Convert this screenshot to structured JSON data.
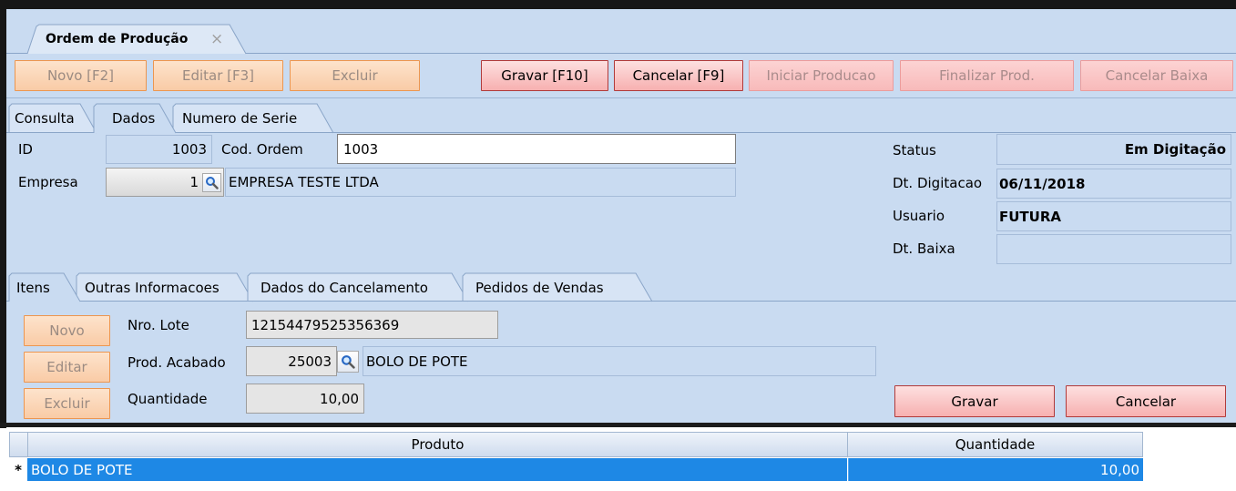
{
  "colors": {
    "panel_background": "#c9dbf1",
    "selected_row": "#1e88e5",
    "orange_button": "#f9cba6",
    "pink_button": "#f7b0b0"
  },
  "document_tab": {
    "title": "Ordem de Produção",
    "close_icon": "×"
  },
  "toolbar": {
    "buttons": [
      {
        "label": "Novo [F2]",
        "enabled": false
      },
      {
        "label": "Editar [F3]",
        "enabled": false
      },
      {
        "label": "Excluir",
        "enabled": false
      },
      {
        "label": "Gravar [F10]",
        "enabled": true
      },
      {
        "label": "Cancelar [F9]",
        "enabled": true
      },
      {
        "label": "Iniciar Producao",
        "enabled": false
      },
      {
        "label": "Finalizar Prod.",
        "enabled": false
      },
      {
        "label": "Cancelar Baixa",
        "enabled": false
      }
    ]
  },
  "main_tabs": [
    {
      "label": "Consulta",
      "active": false
    },
    {
      "label": "Dados",
      "active": true
    },
    {
      "label": "Numero de Serie",
      "active": false
    }
  ],
  "form": {
    "id_label": "ID",
    "id_value": "1003",
    "cod_ordem_label": "Cod. Ordem",
    "cod_ordem_value": "1003",
    "empresa_label": "Empresa",
    "empresa_code": "1",
    "empresa_name": "EMPRESA TESTE LTDA",
    "status_label": "Status",
    "status_value": "Em Digitação",
    "dt_digitacao_label": "Dt. Digitacao",
    "dt_digitacao_value": "06/11/2018",
    "usuario_label": "Usuario",
    "usuario_value": "FUTURA",
    "dt_baixa_label": "Dt. Baixa",
    "dt_baixa_value": ""
  },
  "sub_tabs": [
    {
      "label": "Itens",
      "active": true
    },
    {
      "label": "Outras Informacoes",
      "active": false
    },
    {
      "label": "Dados do Cancelamento",
      "active": false
    },
    {
      "label": "Pedidos de Vendas",
      "active": false
    }
  ],
  "items_panel": {
    "novo_button": {
      "label": "Novo",
      "enabled": false
    },
    "editar_button": {
      "label": "Editar",
      "enabled": false
    },
    "excluir_button": {
      "label": "Excluir",
      "enabled": false
    },
    "nro_lote_label": "Nro. Lote",
    "nro_lote_value": "12154479525356369",
    "prod_acabado_label": "Prod. Acabado",
    "prod_code": "25003",
    "prod_name": "BOLO DE POTE",
    "quantidade_label": "Quantidade",
    "quantidade_value": "10,00",
    "gravar_button": {
      "label": "Gravar",
      "enabled": true
    },
    "cancelar_button": {
      "label": "Cancelar",
      "enabled": true
    }
  },
  "grid": {
    "columns": [
      "Produto",
      "Quantidade"
    ],
    "rows": [
      {
        "indicator": "*",
        "produto": "BOLO DE POTE",
        "quantidade": "10,00",
        "selected": true
      }
    ]
  },
  "icons": {
    "lookup": "search-icon",
    "close": "close-icon"
  }
}
